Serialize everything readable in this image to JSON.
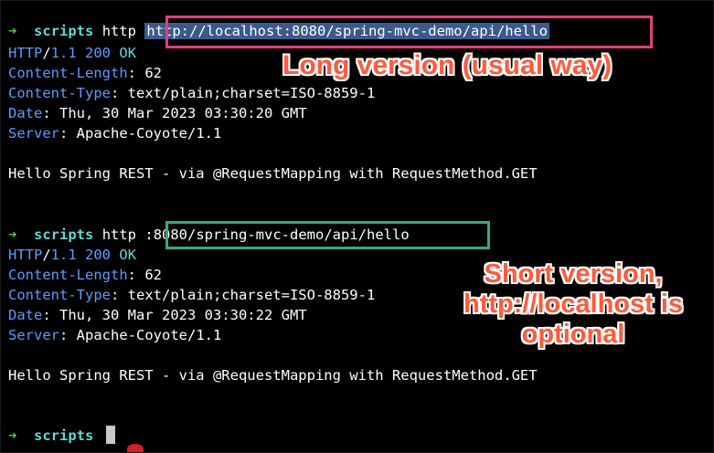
{
  "session1": {
    "prompt_arrow": "➜",
    "dir": "scripts",
    "cmd": "http",
    "url": "http://localhost:8080/spring-mvc-demo/api/hello",
    "status_proto": "HTTP",
    "status_slash": "/",
    "status_version": "1.1",
    "status_code": "200",
    "status_text": "OK",
    "headers": [
      {
        "key": "Content-Length",
        "value": "62"
      },
      {
        "key": "Content-Type",
        "value": "text/plain;charset=ISO-8859-1"
      },
      {
        "key": "Date",
        "value": "Thu, 30 Mar 2023 03:30:20 GMT"
      },
      {
        "key": "Server",
        "value": "Apache-Coyote/1.1"
      }
    ],
    "body": "Hello Spring REST - via @RequestMapping with RequestMethod.GET"
  },
  "session2": {
    "prompt_arrow": "➜",
    "dir": "scripts",
    "cmd": "http",
    "url": ":8080/spring-mvc-demo/api/hello",
    "status_proto": "HTTP",
    "status_slash": "/",
    "status_version": "1.1",
    "status_code": "200",
    "status_text": "OK",
    "headers": [
      {
        "key": "Content-Length",
        "value": "62"
      },
      {
        "key": "Content-Type",
        "value": "text/plain;charset=ISO-8859-1"
      },
      {
        "key": "Date",
        "value": "Thu, 30 Mar 2023 03:30:22 GMT"
      },
      {
        "key": "Server",
        "value": "Apache-Coyote/1.1"
      }
    ],
    "body": "Hello Spring REST - via @RequestMapping with RequestMethod.GET"
  },
  "prompt_final": {
    "prompt_arrow": "➜",
    "dir": "scripts"
  },
  "annotations": {
    "long_label": "Long version (usual way)",
    "short_line1": "Short version,",
    "short_line2": "http://localhost is",
    "short_line3": "optional"
  },
  "colors": {
    "long_box": "#e0407a",
    "short_box": "#2fa98c",
    "callout_text": "#ff5a3c",
    "prompt_arrow": "#4ec94e",
    "directory": "#5fd7d7",
    "header_key": "#5b9bff"
  },
  "icons": {
    "cursor": "block-cursor-icon"
  }
}
